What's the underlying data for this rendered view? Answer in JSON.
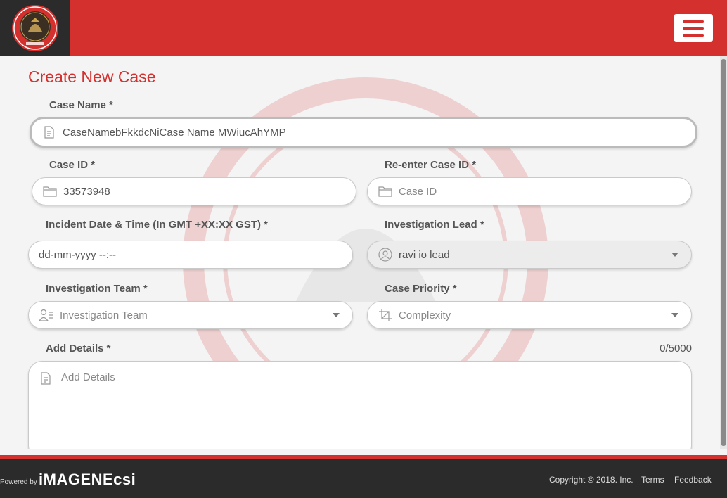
{
  "header": {
    "logo_icon": "police-emblem-icon",
    "menu_icon": "hamburger-menu-icon",
    "brand_color": "#d3302e"
  },
  "form": {
    "title": "Create New Case",
    "case_name": {
      "label": "Case Name *",
      "value": "CaseNamebFkkdcNiCase Name MWiucAhYMP",
      "icon": "document-icon"
    },
    "case_id": {
      "label": "Case ID *",
      "value": "33573948",
      "icon": "folder-icon"
    },
    "reenter_case_id": {
      "label": "Re-enter Case ID *",
      "placeholder": "Case ID",
      "icon": "folder-icon"
    },
    "incident_datetime": {
      "label": "Incident Date & Time (In GMT +XX:XX GST) *",
      "placeholder": "dd-mm-yyyy --:--"
    },
    "investigation_lead": {
      "label": "Investigation Lead *",
      "value": "ravi io lead",
      "icon": "user-icon"
    },
    "investigation_team": {
      "label": "Investigation Team *",
      "placeholder": "Investigation Team",
      "icon": "team-list-icon"
    },
    "case_priority": {
      "label": "Case Priority *",
      "placeholder": "Complexity",
      "icon": "crop-icon"
    },
    "add_details": {
      "label": "Add Details *",
      "placeholder": "Add Details",
      "counter": "0/5000",
      "icon": "document-icon"
    }
  },
  "footer": {
    "powered_by": "Powered by",
    "brand": "iMAGENEcsi",
    "copyright": "Copyright © 2018. Inc.",
    "terms": "Terms",
    "feedback": "Feedback"
  }
}
